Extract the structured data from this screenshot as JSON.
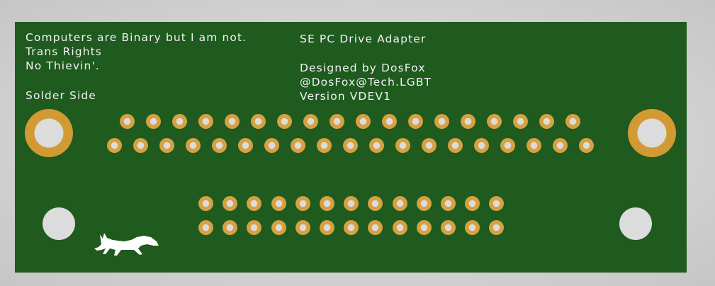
{
  "silkscreen": {
    "left_lines": [
      "Computers are Binary but I am not.",
      "Trans Rights",
      "No Thievin'."
    ],
    "side_label": "Solder Side",
    "title": "SE PC Drive Adapter",
    "credits": [
      "Designed by DosFox",
      "@DosFox@Tech.LGBT",
      "Version VDEV1"
    ]
  },
  "colors": {
    "board": "#1f5a1f",
    "pad_copper": "#d6a140",
    "drill": "#dcdcdc",
    "silkscreen": "#f2f2f2"
  },
  "icons": {
    "logo": "fox-logo"
  }
}
